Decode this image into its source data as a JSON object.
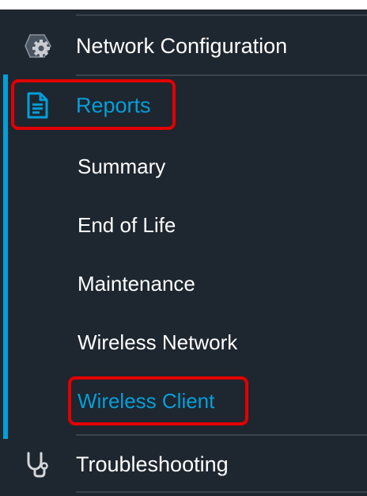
{
  "colors": {
    "background": "#1e262f",
    "text": "#ffffff",
    "accent": "#049fd9",
    "highlight_border": "#e10000",
    "divider": "#3a434d"
  },
  "menu": {
    "network_configuration": {
      "label": "Network Configuration",
      "icon": "gear-icon"
    },
    "reports": {
      "label": "Reports",
      "icon": "document-icon",
      "active": true
    },
    "report_items": [
      {
        "label": "Summary"
      },
      {
        "label": "End of Life"
      },
      {
        "label": "Maintenance"
      },
      {
        "label": "Wireless Network"
      },
      {
        "label": "Wireless Client",
        "selected": true
      }
    ],
    "troubleshooting": {
      "label": "Troubleshooting",
      "icon": "stethoscope-icon"
    }
  }
}
